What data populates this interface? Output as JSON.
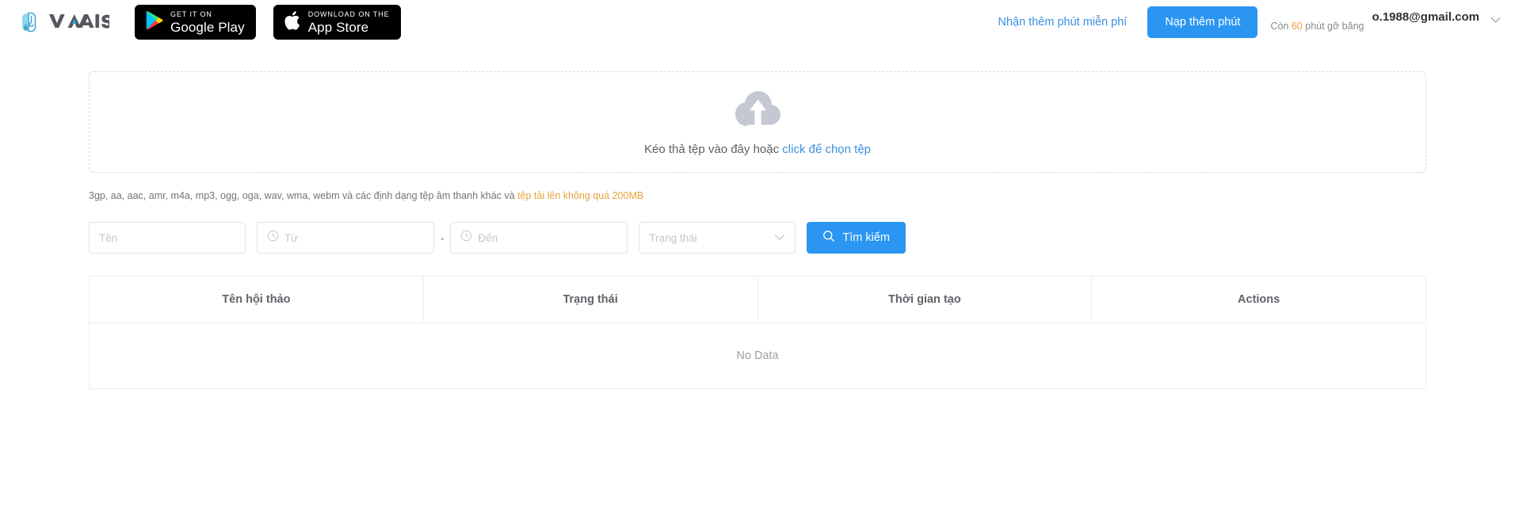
{
  "header": {
    "brand_name": "VAIS",
    "badges": [
      {
        "id": "google-play",
        "small": "GET IT ON",
        "big": "Google Play",
        "icon": "google-play-icon"
      },
      {
        "id": "app-store",
        "small": "Download on the",
        "big": "App Store",
        "icon": "apple-icon"
      }
    ],
    "free_minutes_link": "Nhận thêm phút miễn phí",
    "topup_button": "Nạp thêm phút",
    "quota_prefix": "Còn",
    "quota_amount": "60",
    "quota_suffix": "phút gỡ băng",
    "account_email": "o.1988@gmail.com",
    "caret_icon": "chevron-down-icon",
    "accent_color": "#2b96f1",
    "warning_color": "#e8a33d"
  },
  "upload": {
    "icon": "cloud-upload-icon",
    "prompt_text": "Kéo thả tệp vào đây hoặc",
    "prompt_link": "click để chọn tệp",
    "hint_text": "3gp, aa, aac, amr, m4a, mp3, ogg, oga, wav, wma, webm và các định dạng tệp âm thanh khác và",
    "hint_limit": "tệp tải lên không quá 200MB"
  },
  "filters": {
    "name_placeholder": "Tên",
    "from_placeholder": "Từ",
    "to_placeholder": "Đến",
    "range_separator": "-",
    "status_value": "Trạng thái",
    "search_button": "Tìm kiếm",
    "search_icon": "search-icon",
    "clock_icon": "clock-icon",
    "caret_icon": "chevron-down-icon"
  },
  "table": {
    "columns": [
      {
        "label": "Tên hội thảo"
      },
      {
        "label": "Trạng thái"
      },
      {
        "label": "Thời gian tạo"
      },
      {
        "label": "Actions"
      }
    ],
    "empty_text": "No Data"
  }
}
